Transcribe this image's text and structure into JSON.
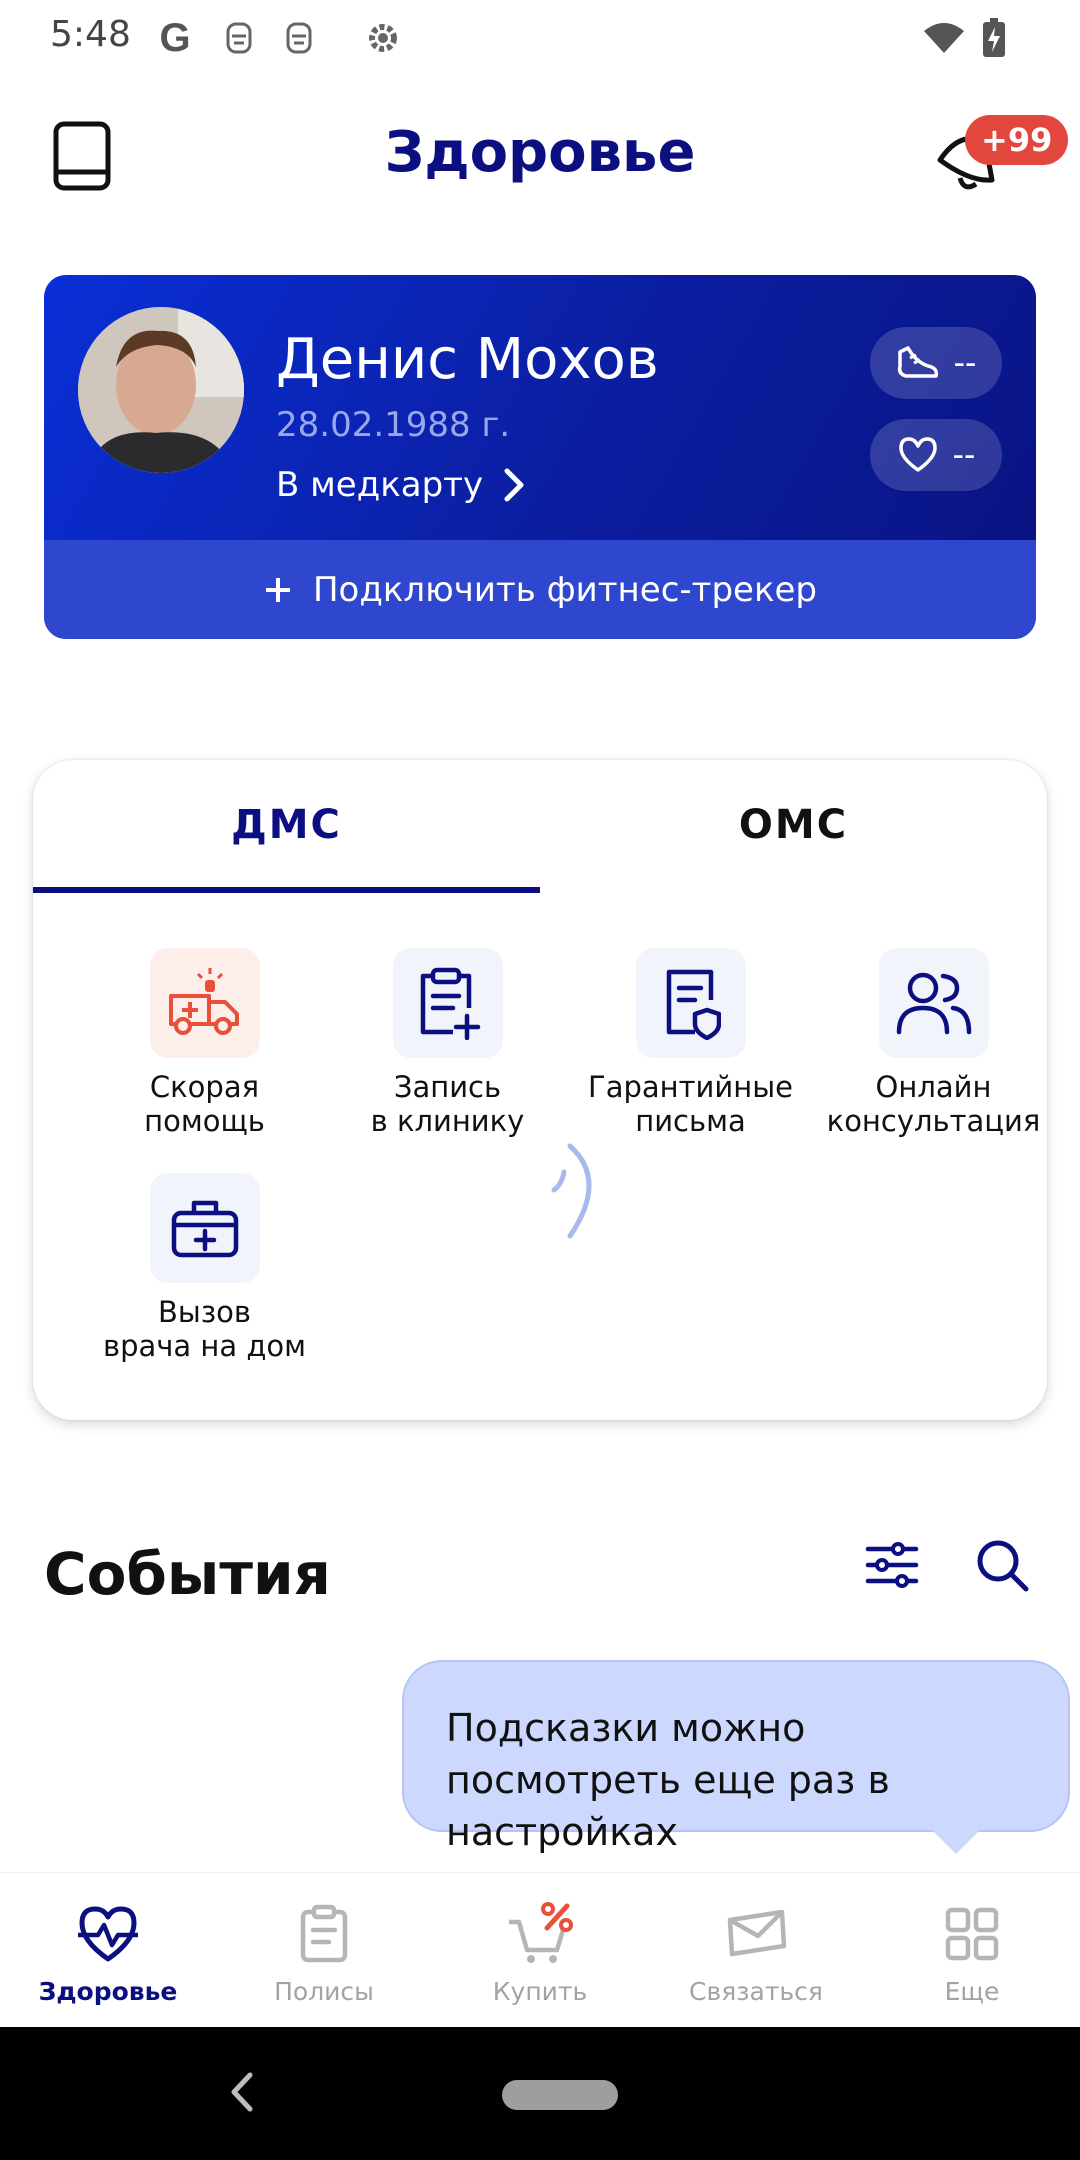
{
  "status_bar": {
    "time": "5:48",
    "google_letter": "G"
  },
  "header": {
    "title": "Здоровье",
    "notifications_badge": "+99"
  },
  "profile": {
    "name": "Денис Мохов",
    "dob": "28.02.1988 г.",
    "medcard_link": "В медкарту",
    "steps_value": "--",
    "pulse_value": "--",
    "fitness_tracker_label": "Подключить фитнес-трекер"
  },
  "services": {
    "tabs": [
      {
        "label": "ДМС",
        "active": true
      },
      {
        "label": "ОМС",
        "active": false
      }
    ],
    "items": [
      {
        "label": "Скорая\nпомощь",
        "icon": "ambulance-icon"
      },
      {
        "label": "Запись\nв клинику",
        "icon": "clipboard-plus-icon"
      },
      {
        "label": "Гарантийные\nписьма",
        "icon": "document-shield-icon"
      },
      {
        "label": "Онлайн\nконсультация",
        "icon": "people-icon"
      },
      {
        "label": "Вызов\nврача на дом",
        "icon": "medkit-icon"
      }
    ]
  },
  "events": {
    "title": "События"
  },
  "tooltip": {
    "text": "Подсказки можно посмотреть еще раз в настройках"
  },
  "bottom_nav": [
    {
      "label": "Здоровье",
      "icon": "heart-pulse-icon",
      "active": true
    },
    {
      "label": "Полисы",
      "icon": "clipboard-icon",
      "active": false
    },
    {
      "label": "Купить",
      "icon": "cart-percent-icon",
      "active": false
    },
    {
      "label": "Связаться",
      "icon": "envelope-icon",
      "active": false
    },
    {
      "label": "Еще",
      "icon": "grid-icon",
      "active": false
    }
  ],
  "colors": {
    "brand": "#0c0f7f",
    "card_gradient_start": "#0a2fd7",
    "badge_red": "#e1473c",
    "tooltip_bg": "#cdd8ff",
    "ambulance_accent": "#e8503a"
  }
}
